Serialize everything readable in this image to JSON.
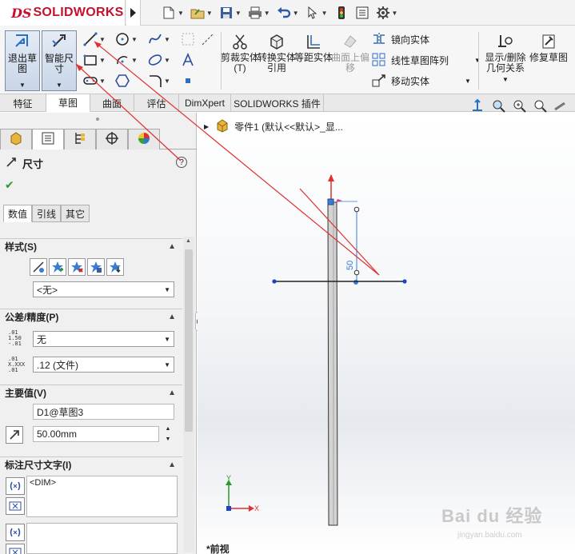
{
  "app": {
    "logo_ds": "DS",
    "logo_text": "SOLIDWORKS"
  },
  "ribbon": {
    "exit_sketch": "退出草图",
    "smart_dimension": "智能尺寸",
    "trim_entities": "剪裁实体(T)",
    "convert_entities": "转换实体引用",
    "offset_entities": "等距实体",
    "offset_on_surface": "曲面上偏移",
    "mirror_entities": "镜向实体",
    "linear_pattern": "线性草图阵列",
    "move_entities": "移动实体",
    "display_relations": "显示/删除几何关系",
    "repair_sketch": "修复草图"
  },
  "tabs": [
    {
      "label": "特征"
    },
    {
      "label": "草图"
    },
    {
      "label": "曲面"
    },
    {
      "label": "评估"
    },
    {
      "label": "DimXpert"
    },
    {
      "label": "SOLIDWORKS 插件"
    }
  ],
  "pm": {
    "title": "尺寸",
    "subtabs": [
      "数值",
      "引线",
      "其它"
    ],
    "style_group": "样式(S)",
    "style_value": "<无>",
    "tolerance_group": "公差/精度(P)",
    "tol_value": "无",
    "precision_value": ".12 (文件)",
    "tol_icon_text": ".01\n1.50\n-.01",
    "prec_icon_text": ".01\nX.XXX\n.01",
    "primary_group": "主要值(V)",
    "primary_name": "D1@草图3",
    "primary_value": "50.00mm",
    "dimtext_group": "标注尺寸文字(I)",
    "dimtext_value": "<DIM>"
  },
  "graphics": {
    "tree_label": "零件1  (默认<<默认>_显...",
    "view_label": "*前视",
    "dimension_value": "50",
    "triad_x": "X",
    "triad_y": "Y",
    "watermark": "Bai du 经验",
    "watermark_url": "jingyan.baidu.com"
  },
  "colors": {
    "accent": "#c8102e",
    "annotation_arrow": "#e03030",
    "dimension": "#3a7bd5"
  }
}
